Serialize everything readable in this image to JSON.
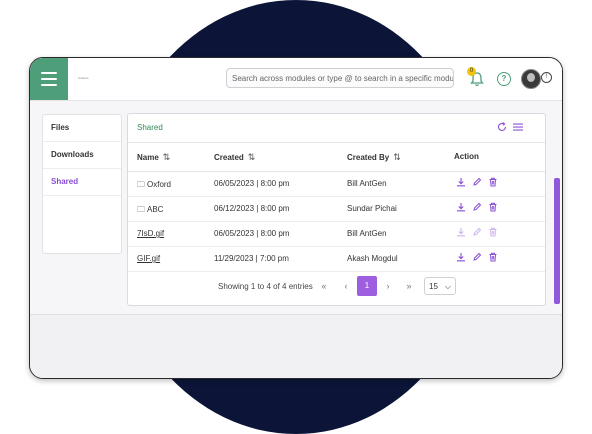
{
  "header": {
    "brand": "Custom",
    "search_placeholder": "Search across modules or type @ to search in a specific module",
    "notification_count": "0",
    "help_glyph": "?",
    "info_glyph": "!"
  },
  "sidebar": {
    "items": [
      {
        "label": "Files",
        "active": false
      },
      {
        "label": "Downloads",
        "active": false
      },
      {
        "label": "Shared",
        "active": true
      }
    ]
  },
  "panel": {
    "title": "Shared",
    "columns": {
      "name": "Name",
      "created": "Created",
      "created_by": "Created By",
      "action": "Action"
    },
    "rows": [
      {
        "name": "Oxford",
        "type": "folder",
        "created": "06/05/2023 | 8:00 pm",
        "created_by": "Bill AntGen",
        "actions_enabled": true
      },
      {
        "name": "ABC",
        "type": "folder",
        "created": "06/12/2023 | 8:00 pm",
        "created_by": "Sundar Pichai",
        "actions_enabled": true
      },
      {
        "name": "7IsD.gif",
        "type": "file",
        "created": "06/05/2023 | 8:00 pm",
        "created_by": "Bill AntGen",
        "actions_enabled": false
      },
      {
        "name": "GIF.gif",
        "type": "file",
        "created": "11/29/2023 | 7:00 pm",
        "created_by": "Akash Mogdul",
        "actions_enabled": true
      }
    ],
    "pager": {
      "info": "Showing 1 to 4 of 4 entries",
      "first": "«",
      "prev": "‹",
      "current": "1",
      "next": "›",
      "last": "»",
      "page_size": "15"
    }
  },
  "colors": {
    "accent": "#9d5fe0",
    "brand_green": "#4e9e7a",
    "title_green": "#2e8b57",
    "backdrop": "#0c1538"
  }
}
